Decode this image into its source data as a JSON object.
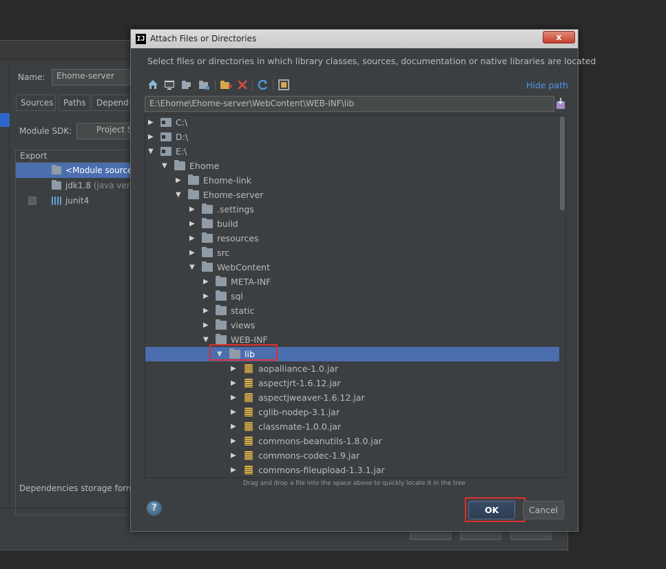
{
  "background_window": {
    "name_label": "Name:",
    "name_value": "Ehome-server",
    "tabs": [
      "Sources",
      "Paths",
      "Depende"
    ],
    "module_sdk_label": "Module SDK:",
    "module_sdk_value": "Project S",
    "table_header": "Export",
    "rows": [
      {
        "label": "<Module source",
        "suffix": ""
      },
      {
        "label": "jdk1.8",
        "suffix": "(java vers"
      },
      {
        "label": "junit4",
        "suffix": ""
      }
    ],
    "storage_label": "Dependencies storage form"
  },
  "dialog": {
    "title": "Attach Files or Directories",
    "close_label": "x",
    "description": "Select files or directories in which library classes, sources, documentation or native libraries are located",
    "hide_path": "Hide path",
    "path_value": "E:\\Ehome\\Ehome-server\\WebContent\\WEB-INF\\lib",
    "drag_hint": "Drag and drop a file into the space above to quickly locate it in the tree",
    "help_label": "?",
    "ok_label": "OK",
    "cancel_label": "Cancel",
    "toolbar_icons": [
      "home-icon",
      "desktop-icon",
      "project-folder-icon",
      "module-folder-icon",
      "new-folder-icon",
      "delete-icon",
      "refresh-icon",
      "show-hidden-icon"
    ],
    "tree": [
      {
        "label": "C:\\",
        "icon": "drive",
        "depth": 0,
        "expanded": false
      },
      {
        "label": "D:\\",
        "icon": "drive",
        "depth": 0,
        "expanded": false
      },
      {
        "label": "E:\\",
        "icon": "drive",
        "depth": 0,
        "expanded": true
      },
      {
        "label": "Ehome",
        "icon": "folder",
        "depth": 1,
        "expanded": true
      },
      {
        "label": "Ehome-link",
        "icon": "folder",
        "depth": 2,
        "expanded": false
      },
      {
        "label": "Ehome-server",
        "icon": "folder",
        "depth": 2,
        "expanded": true
      },
      {
        "label": ".settings",
        "icon": "folder",
        "depth": 3,
        "expanded": false
      },
      {
        "label": "build",
        "icon": "folder",
        "depth": 3,
        "expanded": false
      },
      {
        "label": "resources",
        "icon": "folder",
        "depth": 3,
        "expanded": false
      },
      {
        "label": "src",
        "icon": "folder",
        "depth": 3,
        "expanded": false
      },
      {
        "label": "WebContent",
        "icon": "folder",
        "depth": 3,
        "expanded": true
      },
      {
        "label": "META-INF",
        "icon": "folder",
        "depth": 4,
        "expanded": false
      },
      {
        "label": "sql",
        "icon": "folder",
        "depth": 4,
        "expanded": false
      },
      {
        "label": "static",
        "icon": "folder",
        "depth": 4,
        "expanded": false
      },
      {
        "label": "views",
        "icon": "folder",
        "depth": 4,
        "expanded": false
      },
      {
        "label": "WEB-INF",
        "icon": "folder",
        "depth": 4,
        "expanded": true
      },
      {
        "label": "lib",
        "icon": "folder",
        "depth": 5,
        "expanded": true,
        "selected": true
      },
      {
        "label": "aopalliance-1.0.jar",
        "icon": "jar",
        "depth": 6,
        "expanded": false
      },
      {
        "label": "aspectjrt-1.6.12.jar",
        "icon": "jar",
        "depth": 6,
        "expanded": false
      },
      {
        "label": "aspectjweaver-1.6.12.jar",
        "icon": "jar",
        "depth": 6,
        "expanded": false
      },
      {
        "label": "cglib-nodep-3.1.jar",
        "icon": "jar",
        "depth": 6,
        "expanded": false
      },
      {
        "label": "classmate-1.0.0.jar",
        "icon": "jar",
        "depth": 6,
        "expanded": false
      },
      {
        "label": "commons-beanutils-1.8.0.jar",
        "icon": "jar",
        "depth": 6,
        "expanded": false
      },
      {
        "label": "commons-codec-1.9.jar",
        "icon": "jar",
        "depth": 6,
        "expanded": false
      },
      {
        "label": "commons-fileupload-1.3.1.jar",
        "icon": "jar",
        "depth": 6,
        "expanded": false
      }
    ]
  },
  "colors": {
    "background": "#2b2b2b",
    "panel": "#3c3f41",
    "selection": "#4b6eaf",
    "link": "#5394ec",
    "highlight_box": "#e0302e"
  }
}
